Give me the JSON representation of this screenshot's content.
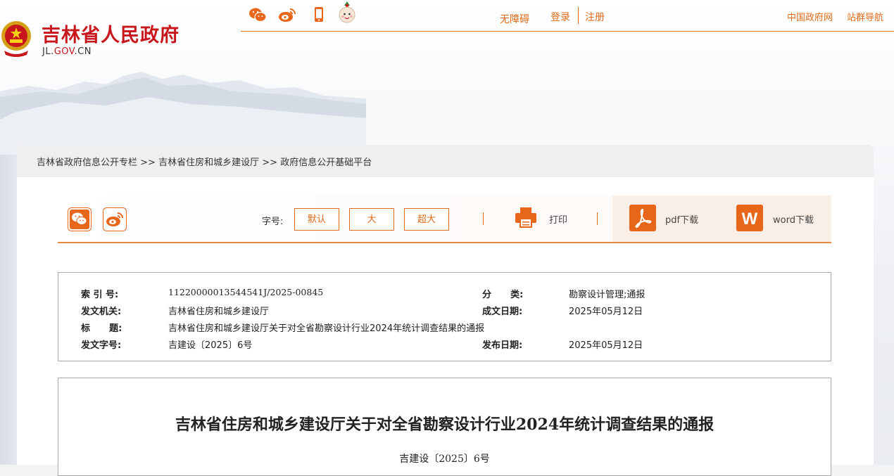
{
  "header": {
    "site_title": "吉林省人民政府",
    "site_domain_prefix": "JL.",
    "site_domain_highlight": "GOV",
    "site_domain_suffix": ".CN",
    "accent_color": "#c8161d",
    "social_icons": [
      "wechat-icon",
      "weibo-icon",
      "mobile-icon",
      "mascot-icon"
    ],
    "links": {
      "accessibility": "无障碍",
      "login": "登录",
      "register": "注册",
      "china_gov": "中国政府网",
      "site_nav": "站群导航"
    }
  },
  "breadcrumb": {
    "items": [
      "吉林省政府信息公开专栏",
      "吉林省住房和城乡建设厅",
      "政府信息公开基础平台"
    ],
    "separator": ">>"
  },
  "toolbar": {
    "share_icons": [
      "wechat-share-icon",
      "weibo-share-icon"
    ],
    "font_size_label": "字号:",
    "font_sizes": [
      "默认",
      "大",
      "超大"
    ],
    "print_label": "打印",
    "pdf_label": "pdf下载",
    "word_label": "word下载",
    "accent_color": "#e06a1a"
  },
  "metadata": {
    "index_label": "索 引 号:",
    "index_value": "11220000013544541J/2025-00845",
    "category_label": "分      类:",
    "category_value": "勘察设计管理;通报",
    "issuer_label": "发文机关:",
    "issuer_value": "吉林省住房和城乡建设厅",
    "written_label": "成文日期:",
    "written_value": "2025年05月12日",
    "title_label": "标      题:",
    "title_value": "吉林省住房和城乡建设厅关于对全省勘察设计行业2024年统计调查结果的通报",
    "docno_label": "发文字号:",
    "docno_value": "吉建设〔2025〕6号",
    "published_label": "发布日期:",
    "published_value": "2025年05月12日"
  },
  "article": {
    "title": "吉林省住房和城乡建设厅关于对全省勘察设计行业2024年统计调查结果的通报",
    "doc_number": "吉建设〔2025〕6号"
  }
}
